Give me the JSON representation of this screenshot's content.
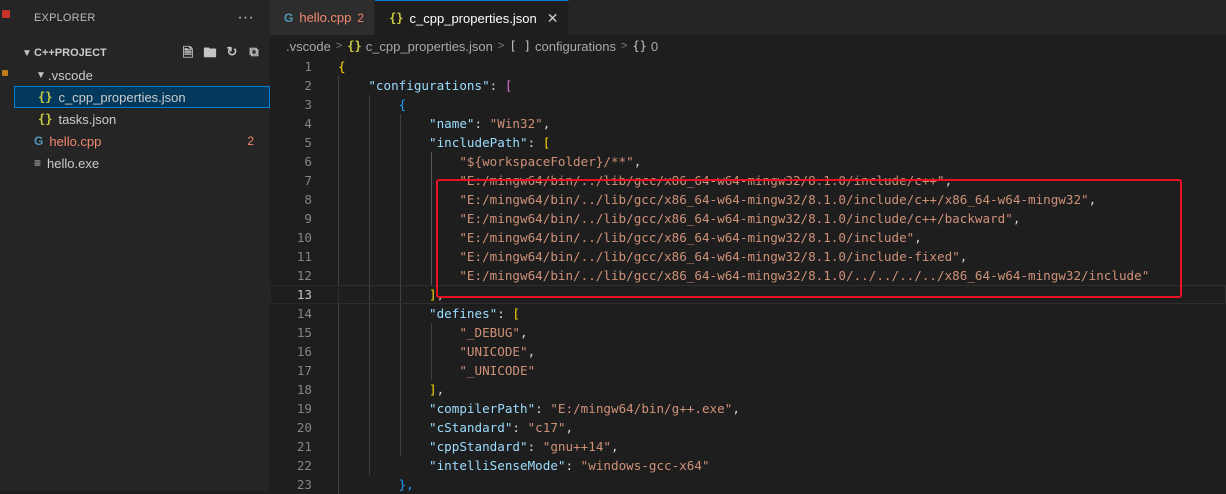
{
  "explorer": {
    "title": "EXPLORER",
    "more": "···",
    "project": "C++PROJECT",
    "tree": [
      {
        "label": ".vscode",
        "kind": "folder",
        "depth": 1
      },
      {
        "label": "c_cpp_properties.json",
        "kind": "json",
        "depth": 2,
        "selected": true
      },
      {
        "label": "tasks.json",
        "kind": "json",
        "depth": 2
      },
      {
        "label": "hello.cpp",
        "kind": "cpp",
        "depth": 1,
        "badge": "2",
        "error": true
      },
      {
        "label": "hello.exe",
        "kind": "exe",
        "depth": 1
      }
    ]
  },
  "tabs": [
    {
      "label": "hello.cpp",
      "badge": "2",
      "active": false,
      "icon": "cpp-file-icon"
    },
    {
      "label": "c_cpp_properties.json",
      "active": true,
      "icon": "json-file-icon"
    }
  ],
  "breadcrumb": {
    "folder": ".vscode",
    "file": "c_cpp_properties.json",
    "array": "configurations",
    "item": "0"
  },
  "code": {
    "current_line": 13,
    "lines": [
      [
        [
          "b1",
          "{"
        ]
      ],
      [
        [
          "pn",
          "    "
        ],
        [
          "key",
          "\"configurations\""
        ],
        [
          "pn",
          ": "
        ],
        [
          "b2",
          "["
        ]
      ],
      [
        [
          "pn",
          "        "
        ],
        [
          "b3",
          "{"
        ]
      ],
      [
        [
          "pn",
          "            "
        ],
        [
          "key",
          "\"name\""
        ],
        [
          "pn",
          ": "
        ],
        [
          "str",
          "\"Win32\""
        ],
        [
          "pn",
          ","
        ]
      ],
      [
        [
          "pn",
          "            "
        ],
        [
          "key",
          "\"includePath\""
        ],
        [
          "pn",
          ": "
        ],
        [
          "b1",
          "["
        ]
      ],
      [
        [
          "pn",
          "                "
        ],
        [
          "str",
          "\"${workspaceFolder}/**\""
        ],
        [
          "pn",
          ","
        ]
      ],
      [
        [
          "pn",
          "                "
        ],
        [
          "str",
          "\"E:/mingw64/bin/../lib/gcc/x86_64-w64-mingw32/8.1.0/include/c++\""
        ],
        [
          "pn",
          ","
        ]
      ],
      [
        [
          "pn",
          "                "
        ],
        [
          "str",
          "\"E:/mingw64/bin/../lib/gcc/x86_64-w64-mingw32/8.1.0/include/c++/x86_64-w64-mingw32\""
        ],
        [
          "pn",
          ","
        ]
      ],
      [
        [
          "pn",
          "                "
        ],
        [
          "str",
          "\"E:/mingw64/bin/../lib/gcc/x86_64-w64-mingw32/8.1.0/include/c++/backward\""
        ],
        [
          "pn",
          ","
        ]
      ],
      [
        [
          "pn",
          "                "
        ],
        [
          "str",
          "\"E:/mingw64/bin/../lib/gcc/x86_64-w64-mingw32/8.1.0/include\""
        ],
        [
          "pn",
          ","
        ]
      ],
      [
        [
          "pn",
          "                "
        ],
        [
          "str",
          "\"E:/mingw64/bin/../lib/gcc/x86_64-w64-mingw32/8.1.0/include-fixed\""
        ],
        [
          "pn",
          ","
        ]
      ],
      [
        [
          "pn",
          "                "
        ],
        [
          "str",
          "\"E:/mingw64/bin/../lib/gcc/x86_64-w64-mingw32/8.1.0/../../../../x86_64-w64-mingw32/include\""
        ]
      ],
      [
        [
          "pn",
          "            "
        ],
        [
          "b1",
          "]"
        ],
        [
          "pn",
          ","
        ]
      ],
      [
        [
          "pn",
          "            "
        ],
        [
          "key",
          "\"defines\""
        ],
        [
          "pn",
          ": "
        ],
        [
          "b1",
          "["
        ]
      ],
      [
        [
          "pn",
          "                "
        ],
        [
          "str",
          "\"_DEBUG\""
        ],
        [
          "pn",
          ","
        ]
      ],
      [
        [
          "pn",
          "                "
        ],
        [
          "str",
          "\"UNICODE\""
        ],
        [
          "pn",
          ","
        ]
      ],
      [
        [
          "pn",
          "                "
        ],
        [
          "str",
          "\"_UNICODE\""
        ]
      ],
      [
        [
          "pn",
          "            "
        ],
        [
          "b1",
          "]"
        ],
        [
          "pn",
          ","
        ]
      ],
      [
        [
          "pn",
          "            "
        ],
        [
          "key",
          "\"compilerPath\""
        ],
        [
          "pn",
          ": "
        ],
        [
          "str",
          "\"E:/mingw64/bin/g++.exe\""
        ],
        [
          "pn",
          ","
        ]
      ],
      [
        [
          "pn",
          "            "
        ],
        [
          "key",
          "\"cStandard\""
        ],
        [
          "pn",
          ": "
        ],
        [
          "str",
          "\"c17\""
        ],
        [
          "pn",
          ","
        ]
      ],
      [
        [
          "pn",
          "            "
        ],
        [
          "key",
          "\"cppStandard\""
        ],
        [
          "pn",
          ": "
        ],
        [
          "str",
          "\"gnu++14\""
        ],
        [
          "pn",
          ","
        ]
      ],
      [
        [
          "pn",
          "            "
        ],
        [
          "key",
          "\"intelliSenseMode\""
        ],
        [
          "pn",
          ": "
        ],
        [
          "str",
          "\"windows-gcc-x64\""
        ]
      ],
      [
        [
          "pn",
          "        "
        ],
        [
          "b3",
          "},"
        ]
      ]
    ]
  },
  "colors": {
    "accent": "#0078d4",
    "error": "#f48771",
    "highlight_box": "#e81123"
  }
}
